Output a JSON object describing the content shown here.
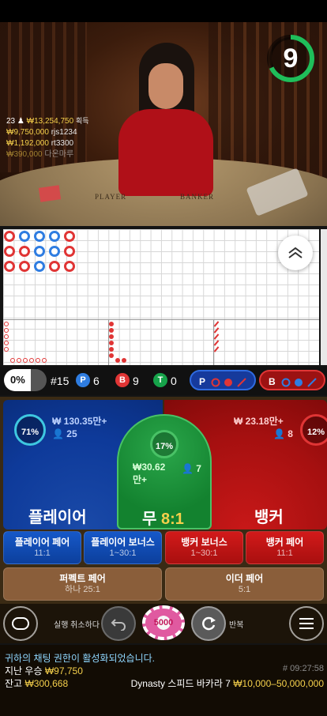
{
  "timer": {
    "seconds": "9",
    "color": "#1fbe5a"
  },
  "winners": [
    {
      "text": "23 ♟ ₩13,254,750 획득",
      "amount": "₩13,254,750",
      "prefix": "23 ♟",
      "suffix": "획득"
    },
    {
      "amount": "₩9,750,000",
      "user": "rjs1234"
    },
    {
      "amount": "₩1,192,000",
      "user": "rt3300"
    },
    {
      "amount": "₩390,000",
      "user": "다온마루"
    }
  ],
  "table_labels": {
    "player": "PLAYER",
    "banker": "BANKER"
  },
  "stats": {
    "pct": "0%",
    "round": "#15",
    "p_badge": "P",
    "p_count": "6",
    "b_badge": "B",
    "b_count": "9",
    "t_badge": "T",
    "t_count": "0",
    "predict_p": "P",
    "predict_b": "B"
  },
  "bet": {
    "player": {
      "label": "플레이어",
      "amount": "₩ 130.35만+",
      "players": "25",
      "pct": "71%"
    },
    "tie": {
      "label": "무",
      "payout": "8:1",
      "amount": "₩30.62만+",
      "players": "7",
      "pct": "17%"
    },
    "banker": {
      "label": "뱅커",
      "amount": "₩ 23.18만+",
      "players": "8",
      "pct": "12%"
    },
    "side": [
      {
        "label": "플레이어 페어",
        "payout": "11:1"
      },
      {
        "label": "플레이어 보너스",
        "payout": "1~30:1"
      },
      {
        "label": "뱅커 보너스",
        "payout": "1~30:1"
      },
      {
        "label": "뱅커 페어",
        "payout": "11:1"
      },
      {
        "label": "퍼펙트 페어",
        "payout": "하나 25:1"
      },
      {
        "label": "이더 페어",
        "payout": "5:1"
      }
    ]
  },
  "controls": {
    "undo_label": "실행 취소하다",
    "chip_value": "5000",
    "repeat_label": "반복"
  },
  "info": {
    "chat_notice": "귀하의 채팅 권한이 활성화되었습니다.",
    "last_win_label": "지난 우승",
    "last_win": "₩97,750",
    "round_id": "# 09:27:58",
    "balance_label": "잔고",
    "balance": "₩300,668",
    "table_name": "Dynasty 스피드 바카라 7",
    "limits": "₩10,000–50,000,000"
  }
}
